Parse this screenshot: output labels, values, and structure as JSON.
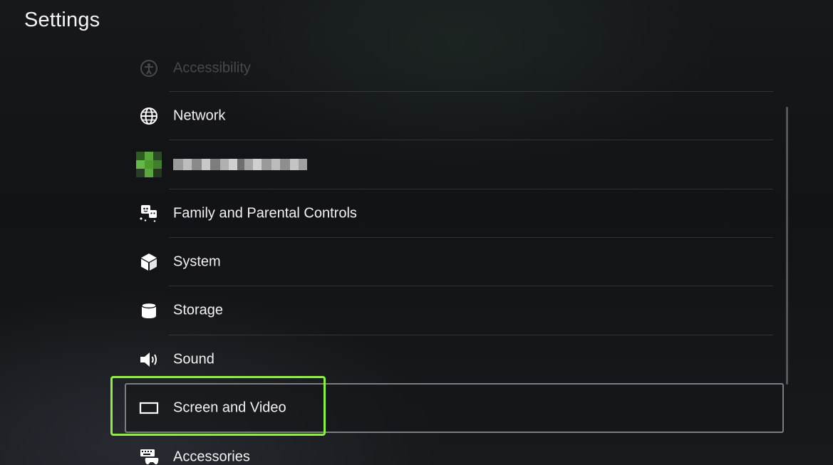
{
  "header": {
    "title": "Settings"
  },
  "menu": {
    "items": [
      {
        "label": "Accessibility",
        "icon": "accessibility-icon",
        "state": "faded"
      },
      {
        "label": "Network",
        "icon": "globe-icon",
        "state": "normal"
      },
      {
        "label": "",
        "icon": "user-avatar-icon",
        "state": "obscured"
      },
      {
        "label": "Family and Parental Controls",
        "icon": "family-icon",
        "state": "normal"
      },
      {
        "label": "System",
        "icon": "cube-icon",
        "state": "normal"
      },
      {
        "label": "Storage",
        "icon": "storage-icon",
        "state": "normal"
      },
      {
        "label": "Sound",
        "icon": "speaker-icon",
        "state": "normal"
      },
      {
        "label": "Screen and Video",
        "icon": "screen-icon",
        "state": "selected"
      },
      {
        "label": "Accessories",
        "icon": "controller-keyboard-icon",
        "state": "normal"
      }
    ]
  },
  "colors": {
    "highlight": "#8df03a",
    "background": "#121316",
    "selection_border": "#7b7d82"
  }
}
